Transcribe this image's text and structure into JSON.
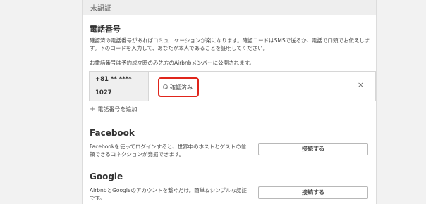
{
  "header": {
    "title": "未認証"
  },
  "phone": {
    "title": "電話番号",
    "description": "確認済の電話番号があればコミュニケーションが楽になります。確認コードはSMSで送るか、電話で口頭でお伝えします。下のコードを入力して、あなたが本人であることを証明してください。",
    "notice": "お電話番号は予約成立時のみ先方のAirbnbメンバーに公開されます。",
    "number_line1": "+81 ** ****",
    "number_line2": "1027",
    "status": "確認済み",
    "remove": "×",
    "add_label": "電話番号を追加",
    "add_icon": "+"
  },
  "facebook": {
    "title": "Facebook",
    "description": "Facebookを使ってログインすると、世界中のホストとゲストの信頼できるコネクションが発掘できます。",
    "button": "接続する"
  },
  "google": {
    "title": "Google",
    "description": "AirbnbとGoogleのアカウントを繋ぐだけ。簡単＆シンプルな認証です。",
    "button": "接続する"
  },
  "colors": {
    "highlight": "#e0251b",
    "header_bg": "#eeeeee",
    "page_bg": "#f2f2f2"
  }
}
